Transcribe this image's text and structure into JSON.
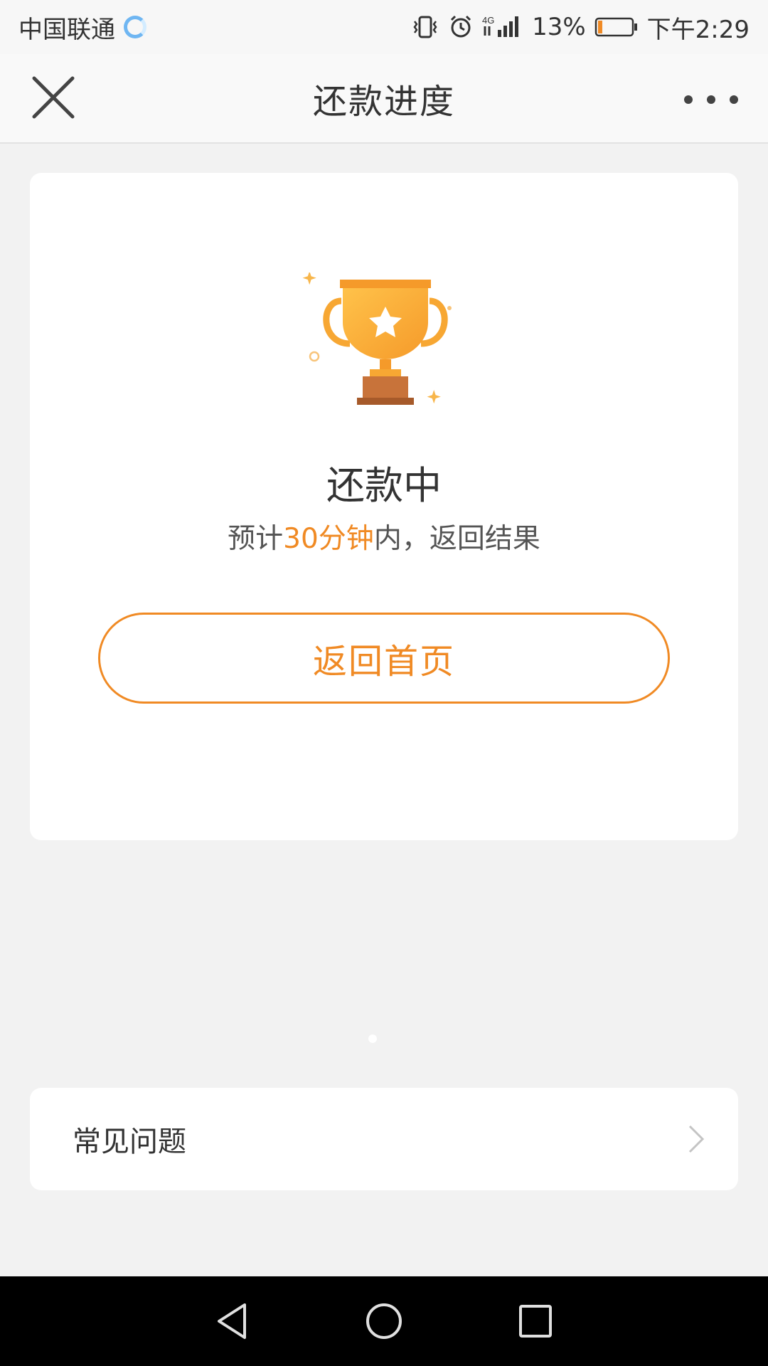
{
  "status_bar": {
    "carrier": "中国联通",
    "network": "4G",
    "battery": "13%",
    "time": "下午2:29",
    "battery_level": 0.13
  },
  "nav": {
    "title": "还款进度"
  },
  "card": {
    "title": "还款中",
    "subtitle_prefix": "预计",
    "subtitle_highlight": "30分钟",
    "subtitle_suffix": "内，返回结果",
    "button_label": "返回首页"
  },
  "faq": {
    "label": "常见问题"
  },
  "colors": {
    "accent": "#f08a24",
    "background": "#f2f2f2"
  }
}
